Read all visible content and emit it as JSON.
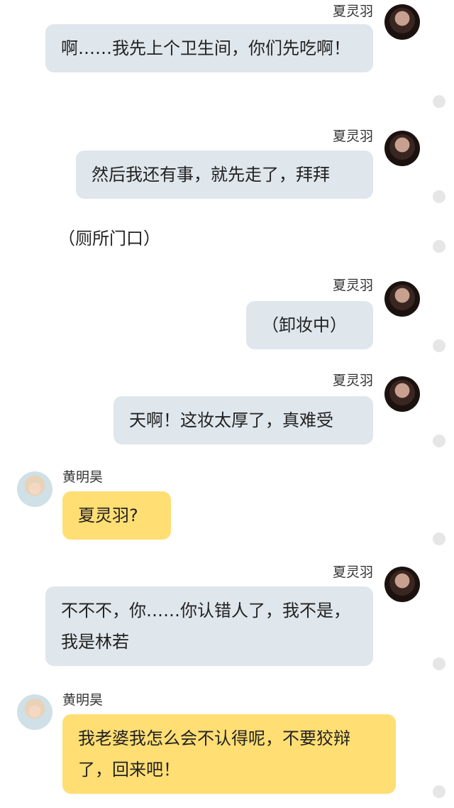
{
  "characters": {
    "female": "夏灵羽",
    "male": "黄明昊"
  },
  "messages": [
    {
      "type": "right",
      "speaker": "夏灵羽",
      "text": "啊……我先上个卫生间，你们先吃啊！"
    },
    {
      "type": "right",
      "speaker": "夏灵羽",
      "text": "然后我还有事，就先走了，拜拜"
    },
    {
      "type": "narration",
      "text": "（厕所门口）"
    },
    {
      "type": "right",
      "speaker": "夏灵羽",
      "text": "（卸妆中）"
    },
    {
      "type": "right",
      "speaker": "夏灵羽",
      "text": "天啊！这妆太厚了，真难受"
    },
    {
      "type": "left",
      "speaker": "黄明昊",
      "text": "夏灵羽?"
    },
    {
      "type": "right",
      "speaker": "夏灵羽",
      "text": "不不不，你……你认错人了，我不是，我是林若"
    },
    {
      "type": "left",
      "speaker": "黄明昊",
      "text": "我老婆我怎么会不认得呢，不要狡辩了，回来吧！"
    }
  ]
}
